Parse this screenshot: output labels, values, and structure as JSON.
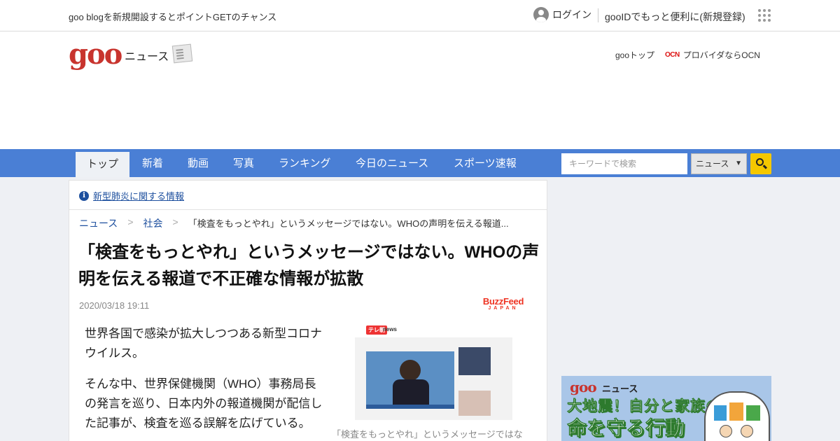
{
  "topbar": {
    "promo": "goo blogを新規開設するとポイントGETのチャンス",
    "login": "ログイン",
    "register": "gooIDでもっと便利に(新規登録)"
  },
  "header": {
    "logo": "goo",
    "section": "ニュース",
    "goo_top": "gooトップ",
    "ocn_logo": "OCN",
    "ocn_text": "プロバイダならOCN"
  },
  "nav": {
    "tabs": [
      "トップ",
      "新着",
      "動画",
      "写真",
      "ランキング",
      "今日のニュース",
      "スポーツ速報"
    ],
    "active_tab": "トップ"
  },
  "search": {
    "placeholder": "キーワードで検索",
    "scope": "ニュース",
    "scope_arrow": "▼"
  },
  "notice": {
    "text": "新型肺炎に関する情報"
  },
  "breadcrumb": {
    "items": [
      "ニュース",
      "社会"
    ],
    "separator": ">",
    "current": "「検査をもっとやれ」というメッセージではない。WHOの声明を伝える報道..."
  },
  "article": {
    "title": "「検査をもっとやれ」というメッセージではない。WHOの声明を伝える報道で不正確な情報が拡散",
    "date": "2020/03/18 19:11",
    "source_main": "BuzzFeed",
    "source_sub": "JAPAN",
    "paragraphs": [
      "世界各国で感染が拡大しつつある新型コロナウイルス。",
      "そんな中、世界保健機関（WHO）事務局長の発言を巡り、日本内外の報道機関が配信した記事が、検査を巡る誤解を広げている。"
    ],
    "image_caption": "「検査をもっとやれ」というメッセージではな",
    "image_header_logo": "テレ朝",
    "image_header_text": "news"
  },
  "sidebar": {
    "banner_logo": "goo",
    "banner_logo_sub": "ニュース",
    "banner_line1": "大地震！自分と家族の",
    "banner_line2": "命を守る行動"
  },
  "colors": {
    "brand_red": "#c8342e",
    "nav_blue": "#4a7fd5",
    "search_yellow": "#f5c800",
    "link_blue": "#1d4f9e"
  }
}
